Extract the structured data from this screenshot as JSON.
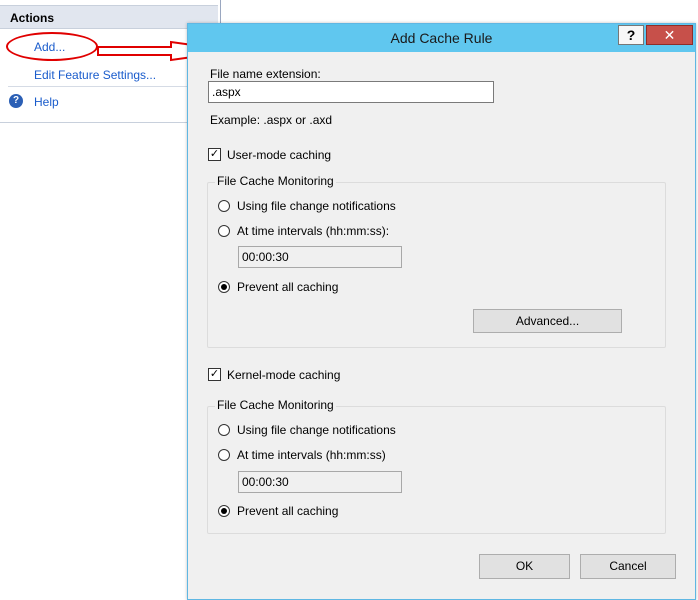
{
  "actions_pane": {
    "header": "Actions",
    "items": [
      {
        "label": "Add..."
      },
      {
        "label": "Edit Feature Settings..."
      },
      {
        "label": "Help"
      }
    ]
  },
  "dialog": {
    "title": "Add Cache Rule",
    "help_button": "?",
    "close_button": "✕",
    "extension": {
      "label": "File name extension:",
      "value": ".aspx",
      "example": "Example: .aspx or .axd"
    },
    "user_mode": {
      "label": "User-mode caching",
      "checked": true,
      "group_title": "File Cache Monitoring",
      "opt_notifications": "Using file change notifications",
      "opt_intervals": "At time intervals (hh:mm:ss):",
      "interval_value": "00:00:30",
      "opt_prevent": "Prevent all caching",
      "selected": "prevent",
      "advanced_button": "Advanced..."
    },
    "kernel_mode": {
      "label": "Kernel-mode caching",
      "checked": true,
      "group_title": "File Cache Monitoring",
      "opt_notifications": "Using file change notifications",
      "opt_intervals": "At time intervals (hh:mm:ss)",
      "interval_value": "00:00:30",
      "opt_prevent": "Prevent all caching",
      "selected": "prevent"
    },
    "ok_button": "OK",
    "cancel_button": "Cancel"
  },
  "colors": {
    "title_bar": "#60c7ef",
    "close_button": "#c7504a",
    "link": "#1a5ccc",
    "annotation": "#e00000"
  }
}
